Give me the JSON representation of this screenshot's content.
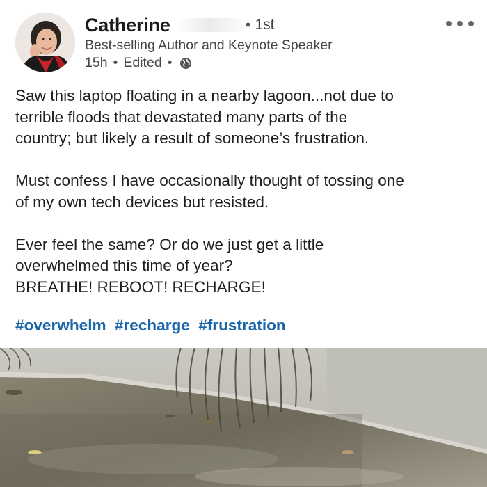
{
  "author": {
    "name": "Catherine",
    "degree": "1st",
    "headline": "Best-selling Author and Keynote Speaker",
    "time": "15h",
    "edited": "Edited",
    "visibility_icon": "globe-icon"
  },
  "menu_icon": "more-options-icon",
  "post": {
    "p1_l1": "Saw this laptop floating in a nearby lagoon...not due to",
    "p1_l2": "terrible floods that devastated many parts of the",
    "p1_l3": "country; but likely a result of someone’s frustration.",
    "p2_l1": "Must confess I have occasionally thought of tossing one",
    "p2_l2": "of my own tech devices but resisted.",
    "p3_l1": "Ever feel the same? Or do we just get a little",
    "p3_l2": "overwhelmed this time of year?",
    "p3_l3": "BREATHE! REBOOT! RECHARGE!",
    "hashtags": [
      "#overwhelm",
      "#recharge",
      "#frustration"
    ]
  },
  "colors": {
    "hashtag": "#1b66a8",
    "text": "#1f1f1f",
    "secondary_text": "#444444"
  }
}
